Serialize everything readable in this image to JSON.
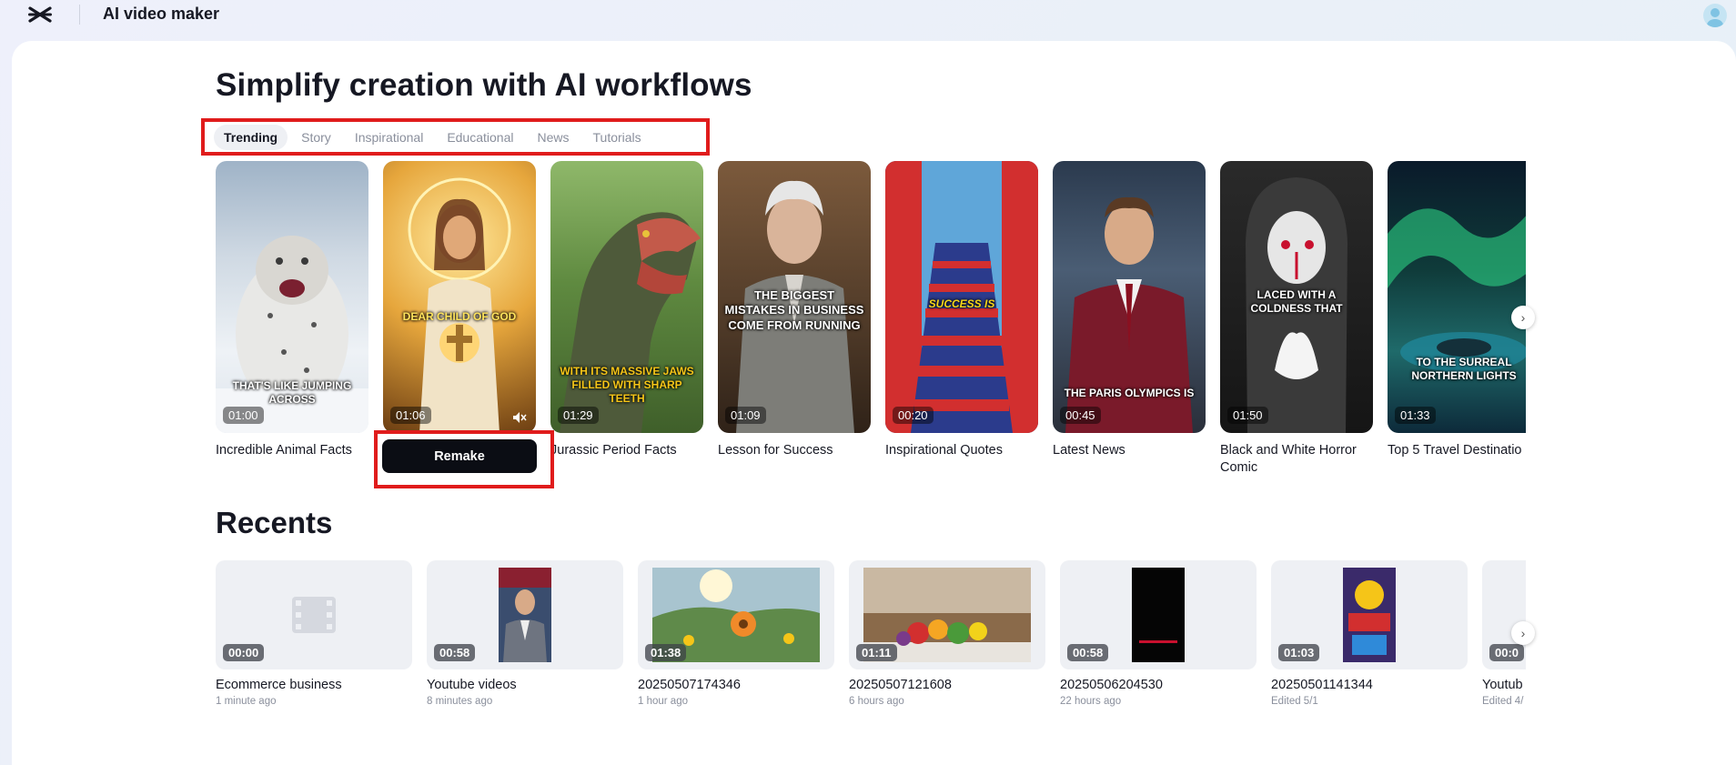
{
  "app": {
    "title": "AI video maker"
  },
  "headline": "Simplify creation with AI workflows",
  "tabs": [
    {
      "label": "Trending",
      "active": true
    },
    {
      "label": "Story",
      "active": false
    },
    {
      "label": "Inspirational",
      "active": false
    },
    {
      "label": "Educational",
      "active": false
    },
    {
      "label": "News",
      "active": false
    },
    {
      "label": "Tutorials",
      "active": false
    }
  ],
  "templates": [
    {
      "name": "Incredible Animal Facts",
      "duration": "01:00",
      "caption": "THAT'S LIKE JUMPING ACROSS",
      "icon": "snow-leopard"
    },
    {
      "name": "",
      "duration": "01:06",
      "caption_top": "DEAR CHILD OF GOD",
      "caption_bottom": "",
      "icon": "jesus"
    },
    {
      "name": "Jurassic Period Facts",
      "duration": "01:29",
      "caption": "WITH ITS MASSIVE JAWS FILLED WITH SHARP TEETH",
      "icon": "dinosaur"
    },
    {
      "name": "Lesson for Success",
      "duration": "01:09",
      "caption": "THE BIGGEST MISTAKES IN BUSINESS COME FROM RUNNING",
      "icon": "old-man"
    },
    {
      "name": "Inspirational Quotes",
      "duration": "00:20",
      "caption": "SUCCESS IS",
      "icon": "staircase"
    },
    {
      "name": "Latest News",
      "duration": "00:45",
      "caption": "THE PARIS OLYMPICS IS",
      "icon": "news-anchor"
    },
    {
      "name": "Black and White Horror Comic",
      "duration": "01:50",
      "caption": "LACED WITH A COLDNESS THAT",
      "icon": "horror-girl"
    },
    {
      "name": "Top 5 Travel Destinatio",
      "duration": "01:33",
      "caption": "TO THE SURREAL NORTHERN LIGHTS",
      "icon": "aurora"
    }
  ],
  "remake_label": "Remake",
  "recents_title": "Recents",
  "recents": [
    {
      "name": "Ecommerce business",
      "time": "1 minute ago",
      "duration": "00:00",
      "icon": "film-icon"
    },
    {
      "name": "Youtube videos",
      "time": "8 minutes ago",
      "duration": "00:58",
      "icon": "man-suit"
    },
    {
      "name": "20250507174346",
      "time": "1 hour ago",
      "duration": "01:38",
      "icon": "flower-field"
    },
    {
      "name": "20250507121608",
      "time": "6 hours ago",
      "duration": "01:11",
      "icon": "vegetables"
    },
    {
      "name": "20250506204530",
      "time": "22 hours ago",
      "duration": "00:58",
      "icon": "black-frame"
    },
    {
      "name": "20250501141344",
      "time": "Edited 5/1",
      "duration": "01:03",
      "icon": "colorful-frame"
    },
    {
      "name": "Youtub",
      "time": "Edited 4/",
      "duration": "00:0",
      "icon": "partial"
    }
  ],
  "colors": {
    "accent_red": "#e01c1c",
    "button_dark": "#0b0d14",
    "text": "#161823",
    "muted": "#8a8f9c"
  }
}
